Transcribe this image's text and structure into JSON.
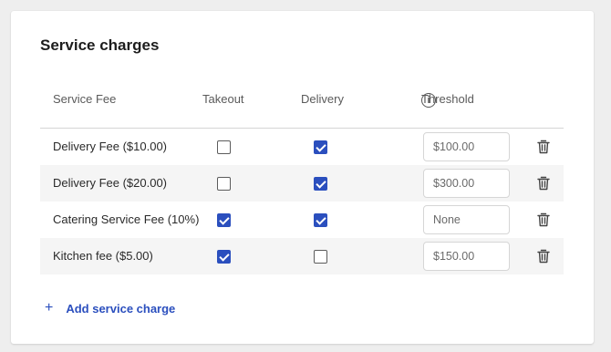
{
  "card": {
    "title": "Service charges"
  },
  "table": {
    "headers": {
      "fee": "Service Fee",
      "takeout": "Takeout",
      "delivery": "Delivery",
      "threshold": "Threshold",
      "threshold_info_icon": "info-icon"
    },
    "rows": [
      {
        "fee": "Delivery Fee ($10.00)",
        "takeout": false,
        "delivery": true,
        "threshold": "$100.00"
      },
      {
        "fee": "Delivery Fee ($20.00)",
        "takeout": false,
        "delivery": true,
        "threshold": "$300.00"
      },
      {
        "fee": "Catering Service Fee (10%)",
        "takeout": true,
        "delivery": true,
        "threshold": "None"
      },
      {
        "fee": "Kitchen fee ($5.00)",
        "takeout": true,
        "delivery": false,
        "threshold": "$150.00"
      }
    ],
    "row_action_icon": "trash-icon"
  },
  "add_button": {
    "icon": "plus-icon",
    "label": "Add service charge"
  },
  "colors": {
    "accent": "#2b4fbe",
    "row_alt": "#f5f5f5",
    "background": "#eeeeee"
  }
}
